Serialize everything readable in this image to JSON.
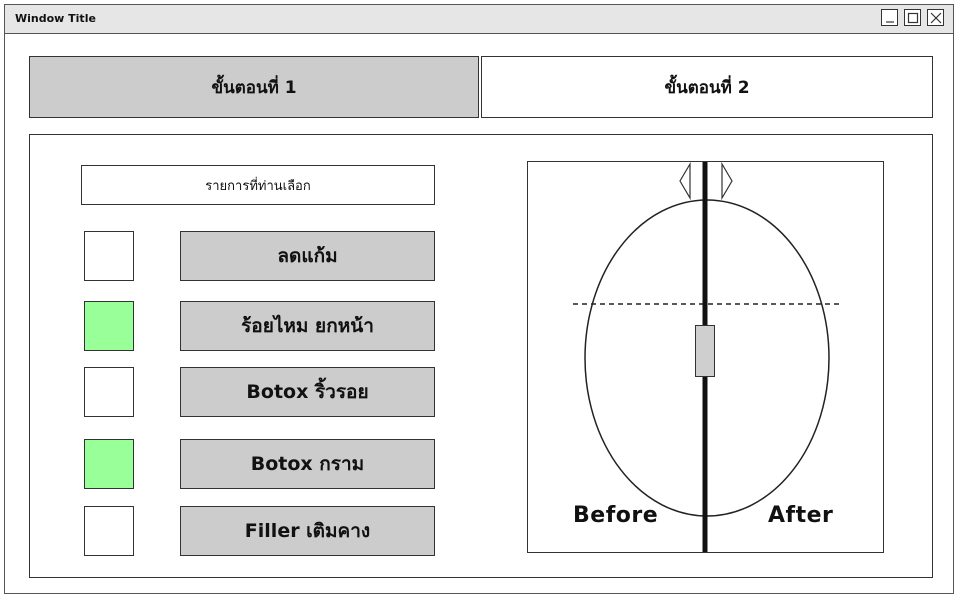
{
  "window": {
    "title": "Window Title",
    "controls": {
      "minimize": "minimize",
      "maximize": "maximize",
      "close": "close"
    }
  },
  "tabs": [
    {
      "label": "ขั้นตอนที่ 1",
      "selected": true
    },
    {
      "label": "ขั้นตอนที่ 2",
      "selected": false
    }
  ],
  "selection": {
    "header": "รายการที่ท่านเลือก",
    "items": [
      {
        "label": "ลดแก้ม",
        "checked": false
      },
      {
        "label": "ร้อยไหม ยกหน้า",
        "checked": true
      },
      {
        "label": "Botox ริ้วรอย",
        "checked": false
      },
      {
        "label": "Botox กราม",
        "checked": true
      },
      {
        "label": "Filler เติมคาง",
        "checked": false
      }
    ]
  },
  "preview": {
    "before_label": "Before",
    "after_label": "After"
  },
  "colors": {
    "selected_tab": "#cccccc",
    "button": "#cccccc",
    "checked": "#99ff99",
    "outline": "#333333"
  }
}
